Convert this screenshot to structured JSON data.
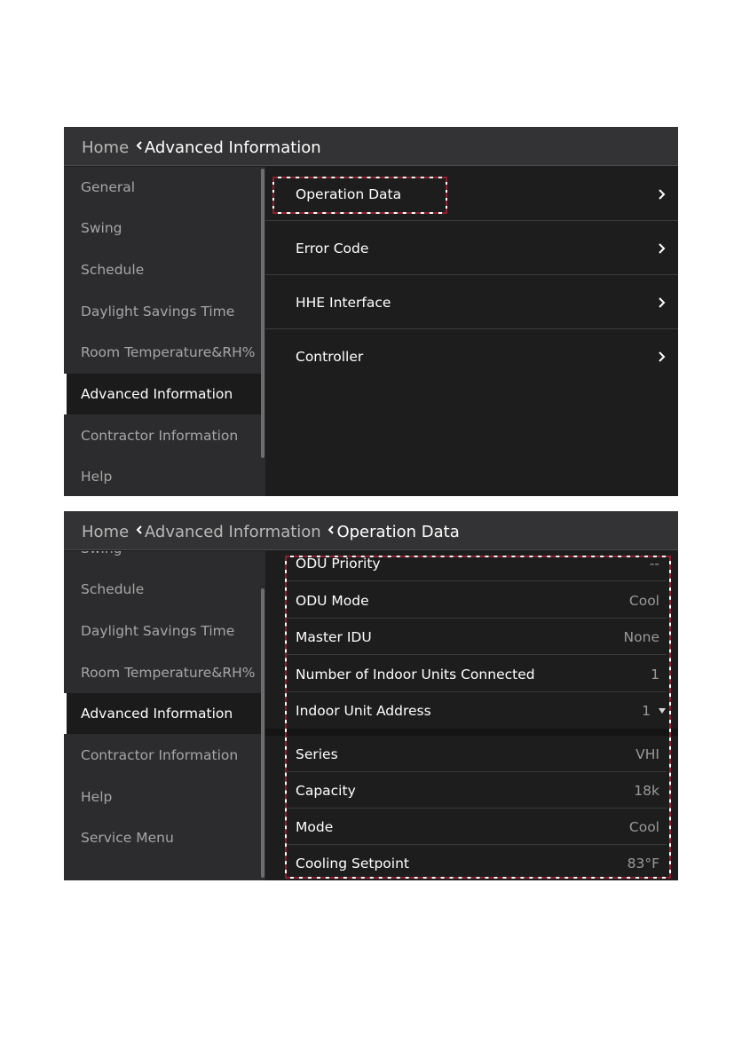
{
  "screen1": {
    "breadcrumb": [
      "Home",
      "Advanced Information"
    ],
    "sidebar": [
      "General",
      "Swing",
      "Schedule",
      "Daylight Savings Time",
      "Room Temperature&RH%",
      "Advanced Information",
      "Contractor Information",
      "Help"
    ],
    "active_sidebar": "Advanced Information",
    "menu": [
      "Operation Data",
      "Error Code",
      "HHE Interface",
      "Controller"
    ],
    "highlighted": "Operation Data"
  },
  "screen2": {
    "breadcrumb": [
      "Home",
      "Advanced Information",
      "Operation Data"
    ],
    "sidebar": [
      "Swing",
      "Schedule",
      "Daylight Savings Time",
      "Room Temperature&RH%",
      "Advanced Information",
      "Contractor Information",
      "Help",
      "Service Menu"
    ],
    "active_sidebar": "Advanced Information",
    "odu_group": [
      {
        "label": "ODU Priority",
        "value": "--"
      },
      {
        "label": "ODU Mode",
        "value": "Cool"
      },
      {
        "label": "Master IDU",
        "value": "None"
      },
      {
        "label": "Number of Indoor Units Connected",
        "value": "1"
      },
      {
        "label": "Indoor Unit Address",
        "value": "1"
      }
    ],
    "idu_group": [
      {
        "label": "Series",
        "value": "VHI"
      },
      {
        "label": "Capacity",
        "value": "18k"
      },
      {
        "label": "Mode",
        "value": "Cool"
      },
      {
        "label": "Cooling Setpoint",
        "value": "83°F"
      }
    ]
  },
  "icons": {
    "breadcrumb_separator": "chevron-left-icon",
    "menu_arrow": "chevron-right-icon",
    "dropdown": "caret-down-icon"
  },
  "colors": {
    "screen_bg": "#1d1d1d",
    "sidebar_bg": "#2c2c2e",
    "header_bg": "#333335",
    "highlight_dash": "#8e1f2c"
  }
}
